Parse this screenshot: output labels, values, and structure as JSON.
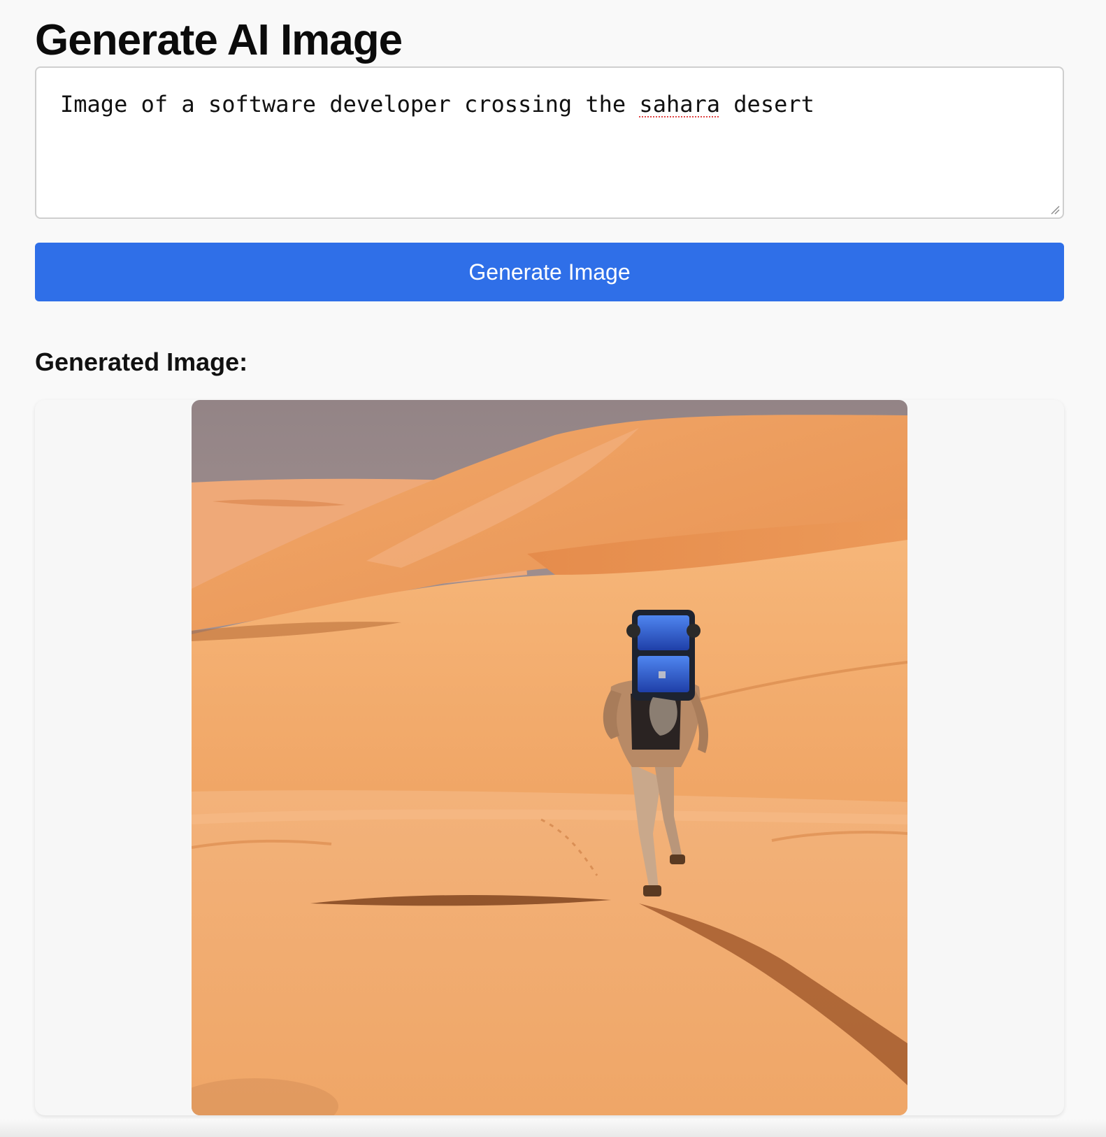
{
  "page": {
    "title": "Generate AI Image"
  },
  "prompt": {
    "before_misspelled": "Image of a software developer crossing the ",
    "misspelled_word": "sahara",
    "after_misspelled": " desert"
  },
  "generate_button": {
    "label": "Generate Image",
    "color": "#2f6fe8"
  },
  "result": {
    "heading": "Generated Image:"
  },
  "icons": {
    "resize": "resize-handle-icon"
  }
}
